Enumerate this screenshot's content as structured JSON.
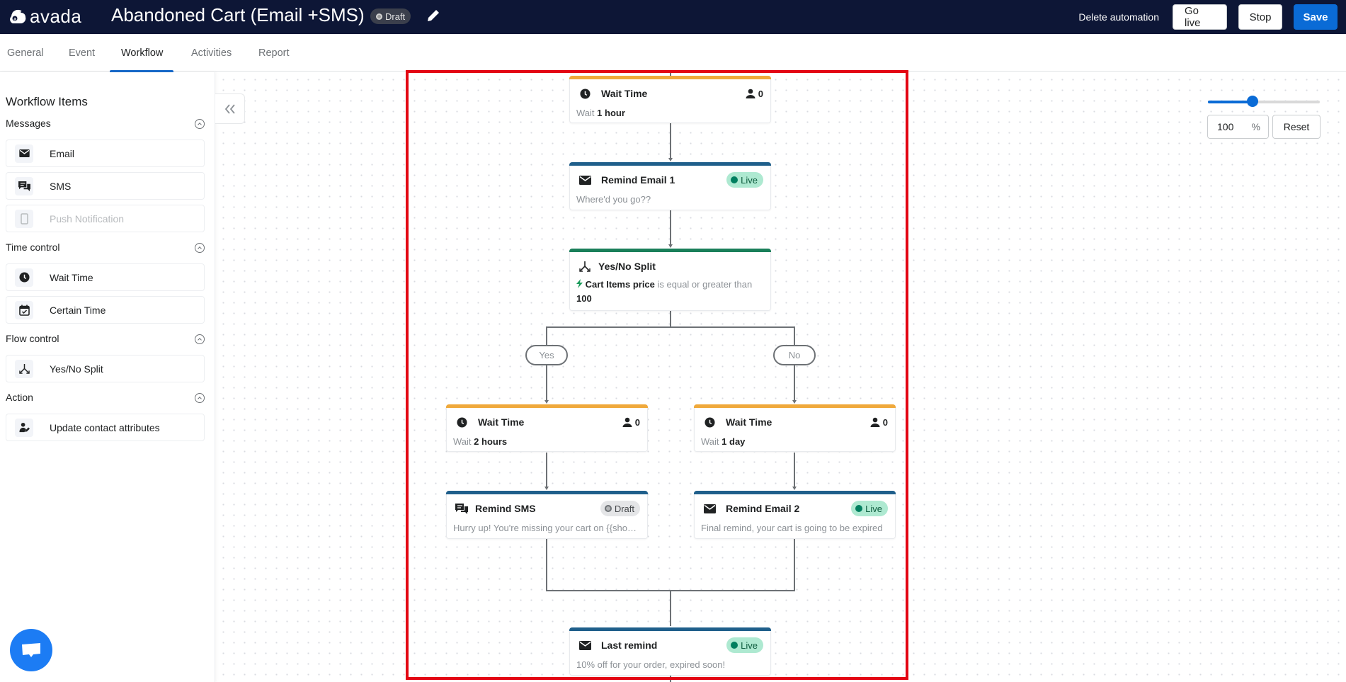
{
  "header": {
    "logo_text": "avada",
    "title": "Abandoned Cart (Email +SMS)",
    "status_badge": "Draft",
    "delete_label": "Delete automation",
    "go_live_label": "Go live",
    "stop_label": "Stop",
    "save_label": "Save"
  },
  "tabs": [
    {
      "label": "General"
    },
    {
      "label": "Event"
    },
    {
      "label": "Workflow",
      "active": true
    },
    {
      "label": "Activities"
    },
    {
      "label": "Report"
    }
  ],
  "sidebar": {
    "title": "Workflow Items",
    "sections": [
      {
        "label": "Messages",
        "items": [
          {
            "label": "Email",
            "icon": "envelope-icon"
          },
          {
            "label": "SMS",
            "icon": "chat-bubbles-icon"
          },
          {
            "label": "Push Notification",
            "icon": "mobile-phone-icon",
            "disabled": true
          }
        ]
      },
      {
        "label": "Time control",
        "items": [
          {
            "label": "Wait Time",
            "icon": "clock-icon"
          },
          {
            "label": "Certain Time",
            "icon": "calendar-check-icon"
          }
        ]
      },
      {
        "label": "Flow control",
        "items": [
          {
            "label": "Yes/No Split",
            "icon": "split-icon"
          }
        ]
      },
      {
        "label": "Action",
        "items": [
          {
            "label": "Update contact attributes",
            "icon": "user-edit-icon"
          }
        ]
      }
    ],
    "collapse_icon": "double-chevron-left-icon"
  },
  "workflow": {
    "wait1": {
      "title": "Wait Time",
      "count": "0",
      "prefix": "Wait",
      "value": "1 hour"
    },
    "email1": {
      "title": "Remind Email 1",
      "status": "Live",
      "subtitle": "Where'd you go??"
    },
    "split": {
      "title": "Yes/No Split",
      "field": "Cart Items price",
      "operator": "is equal or greater than",
      "value": "100"
    },
    "yes_label": "Yes",
    "no_label": "No",
    "wait_yes": {
      "title": "Wait Time",
      "count": "0",
      "prefix": "Wait",
      "value": "2 hours"
    },
    "wait_no": {
      "title": "Wait Time",
      "count": "0",
      "prefix": "Wait",
      "value": "1 day"
    },
    "sms": {
      "title": "Remind SMS",
      "status": "Draft",
      "subtitle": "Hurry up! You're missing your cart on {{shop..."
    },
    "email2": {
      "title": "Remind Email 2",
      "status": "Live",
      "subtitle": "Final remind, your cart is going to be expired"
    },
    "last": {
      "title": "Last remind",
      "status": "Live",
      "subtitle": "10% off for your order, expired soon!"
    }
  },
  "zoom": {
    "value": "100",
    "unit": "%",
    "slider_fraction": 0.4,
    "reset_label": "Reset"
  },
  "colors": {
    "header_bg": "#0d1636",
    "primary": "#0a6bd6",
    "wait_bar": "#f0a93b",
    "message_bar": "#1f5f8b",
    "split_bar": "#1a7f5a",
    "live_bg": "#aee9d1",
    "highlight": "#e30613"
  }
}
